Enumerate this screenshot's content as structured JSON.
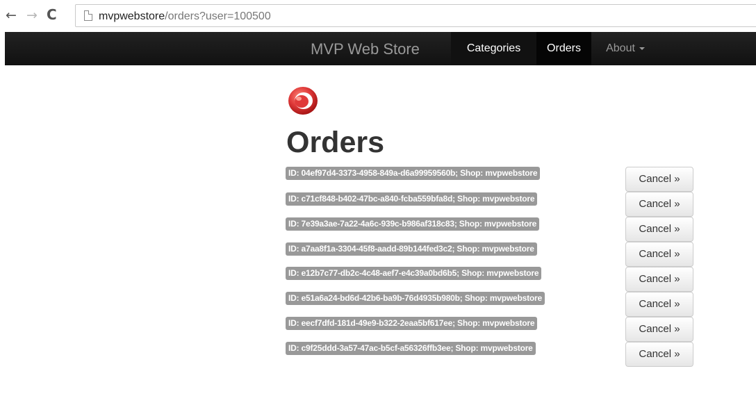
{
  "browser": {
    "back_glyph": "←",
    "forward_glyph": "→",
    "reload_glyph": "C",
    "url_host": "mvpwebstore",
    "url_path": "/orders?user=100500"
  },
  "navbar": {
    "brand": "MVP Web Store",
    "items": [
      {
        "label": "Categories"
      },
      {
        "label": "Orders",
        "active": true
      },
      {
        "label": "About",
        "dropdown": true
      }
    ]
  },
  "logo": {
    "icon": "store-logo-icon",
    "color": "#e03a3a"
  },
  "page": {
    "title": "Orders"
  },
  "orders": [
    {
      "label": "ID: 04ef97d4-3373-4958-849a-d6a99959560b; Shop: mvpwebstore",
      "button": "Cancel »"
    },
    {
      "label": "ID: c71cf848-b402-47bc-a840-fcba559bfa8d; Shop: mvpwebstore",
      "button": "Cancel »"
    },
    {
      "label": "ID: 7e39a3ae-7a22-4a6c-939c-b986af318c83; Shop: mvpwebstore",
      "button": "Cancel »"
    },
    {
      "label": "ID: a7aa8f1a-3304-45f8-aadd-89b144fed3c2; Shop: mvpwebstore",
      "button": "Cancel »"
    },
    {
      "label": "ID: e12b7c77-db2c-4c48-aef7-e4c39a0bd6b5; Shop: mvpwebstore",
      "button": "Cancel »"
    },
    {
      "label": "ID: e51a6a24-bd6d-42b6-ba9b-76d4935b980b; Shop: mvpwebstore",
      "button": "Cancel »"
    },
    {
      "label": "ID: eecf7dfd-181d-49e9-b322-2eaa5bf617ee; Shop: mvpwebstore",
      "button": "Cancel »"
    },
    {
      "label": "ID: c9f25ddd-3a57-47ac-b5cf-a56326ffb3ee; Shop: mvpwebstore",
      "button": "Cancel »"
    }
  ],
  "colors": {
    "navbar": "#111111",
    "label_badge": "#999999",
    "title": "#333333"
  }
}
